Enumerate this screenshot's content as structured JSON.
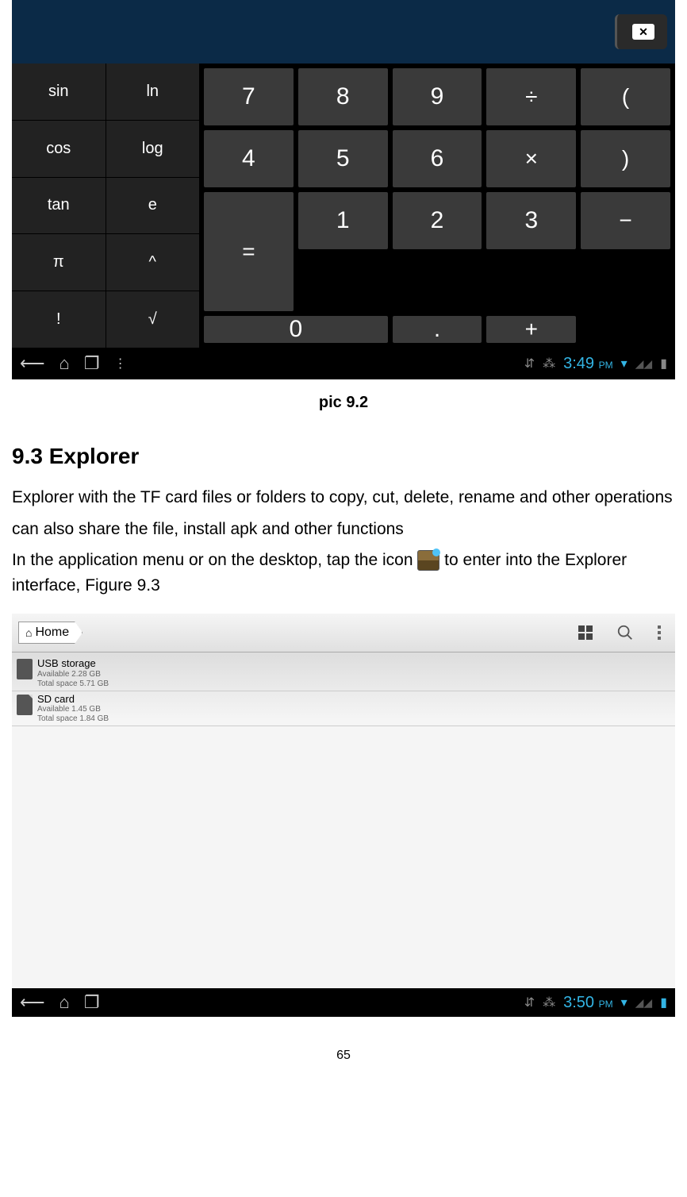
{
  "calculator": {
    "backspace": "✕",
    "sci_keys": [
      "sin",
      "ln",
      "cos",
      "log",
      "tan",
      "e",
      "π",
      "^",
      "!",
      "√"
    ],
    "num_layout": [
      {
        "label": "7",
        "cls": ""
      },
      {
        "label": "8",
        "cls": ""
      },
      {
        "label": "9",
        "cls": ""
      },
      {
        "label": "÷",
        "cls": "op-key"
      },
      {
        "label": "(",
        "cls": "op-key"
      },
      {
        "label": "4",
        "cls": ""
      },
      {
        "label": "5",
        "cls": ""
      },
      {
        "label": "6",
        "cls": ""
      },
      {
        "label": "×",
        "cls": "op-key"
      },
      {
        "label": ")",
        "cls": "op-key"
      },
      {
        "label": "1",
        "cls": ""
      },
      {
        "label": "2",
        "cls": ""
      },
      {
        "label": "3",
        "cls": ""
      },
      {
        "label": "−",
        "cls": "op-key"
      },
      {
        "label": "=",
        "cls": "op-key key-eq"
      },
      {
        "label": "0",
        "cls": "key-0"
      },
      {
        "label": ".",
        "cls": ""
      },
      {
        "label": "+",
        "cls": "op-key"
      }
    ],
    "navbar": {
      "time": "3:49",
      "pm": "PM"
    }
  },
  "caption1": "pic 9.2",
  "section": {
    "title": "9.3 Explorer",
    "p1": "Explorer with the TF card files or folders to copy, cut, delete, rename and other operations",
    "p2": "can also share the file, install apk and other functions",
    "p3a": "In the application menu or on the desktop, tap the icon ",
    "p3b": " to enter into the Explorer interface, Figure 9.3"
  },
  "explorer": {
    "home": "Home",
    "items": [
      {
        "title": "USB storage",
        "line1": "Available 2.28 GB",
        "line2": "Total space 5.71 GB",
        "sd": false
      },
      {
        "title": "SD card",
        "line1": "Available 1.45 GB",
        "line2": "Total space 1.84 GB",
        "sd": true
      }
    ],
    "navbar": {
      "time": "3:50",
      "pm": "PM"
    }
  },
  "page_number": "65"
}
